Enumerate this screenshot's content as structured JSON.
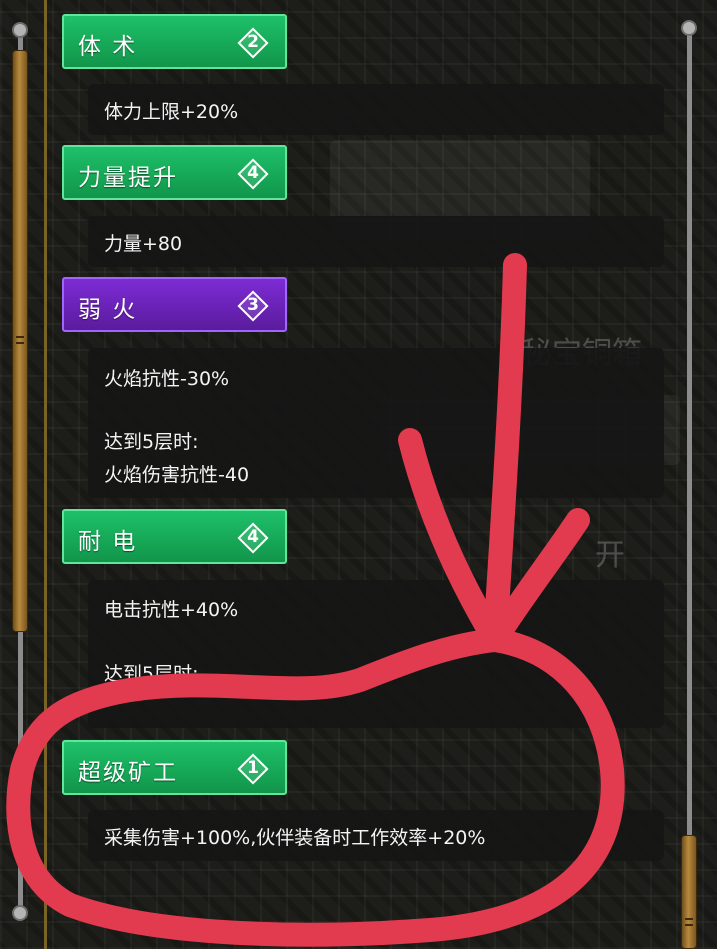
{
  "entries": [
    {
      "title": "体 术",
      "level": "2",
      "variant": "green",
      "lines": [
        "体力上限+20%"
      ]
    },
    {
      "title": "力量提升",
      "level": "4",
      "variant": "green",
      "lines": [
        "力量+80"
      ]
    },
    {
      "title": "弱 火",
      "level": "3",
      "variant": "purple",
      "lines": [
        "火焰抗性-30%",
        "达到5层时:",
        "火焰伤害抗性-40"
      ]
    },
    {
      "title": "耐 电",
      "level": "4",
      "variant": "green",
      "lines": [
        "电击抗性+40%",
        "达到5层时:"
      ]
    },
    {
      "title": "超级矿工",
      "level": "1",
      "variant": "green",
      "lines": [
        "采集伤害+100%,伙伴装备时工作效率+20%"
      ]
    }
  ],
  "background": {
    "ghost_texts": [
      "秘宝铜箱",
      "开"
    ]
  },
  "colors": {
    "green_header": "#16a957",
    "purple_header": "#6a22b7",
    "annotation_red": "#e23a4e"
  },
  "icons": {
    "level_badge": "diamond-badge-icon",
    "scrollbar_knob": "scrollbar-knob-icon"
  }
}
